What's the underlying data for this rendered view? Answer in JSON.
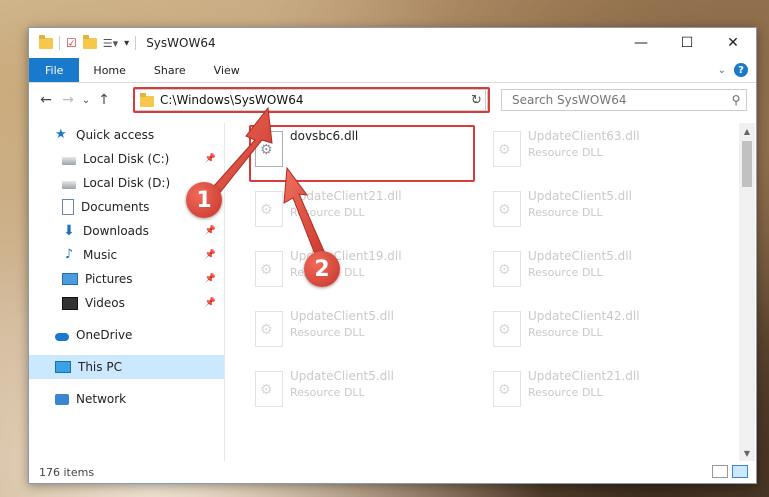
{
  "window": {
    "title": "SysWOW64",
    "controls": {
      "minimize": "—",
      "maximize": "☐",
      "close": "✕"
    }
  },
  "ribbon": {
    "tabs": [
      "File",
      "Home",
      "Share",
      "View"
    ],
    "expand_glyph": "⌄",
    "help": "?"
  },
  "navbar": {
    "back": "←",
    "forward": "→",
    "recent": "⌄",
    "up": "↑",
    "address": "C:\\Windows\\SysWOW64",
    "address_dropdown": "⌄",
    "refresh": "↻",
    "search_placeholder": "Search SysWOW64",
    "search_icon": "⚲"
  },
  "sidebar": {
    "items": [
      {
        "label": "Quick access",
        "icon": "star-icon",
        "pinned": false
      },
      {
        "label": "Local Disk (C:)",
        "icon": "drive-icon",
        "pinned": true
      },
      {
        "label": "Local Disk (D:)",
        "icon": "drive-icon",
        "pinned": false
      },
      {
        "label": "Documents",
        "icon": "documents-icon",
        "pinned": true
      },
      {
        "label": "Downloads",
        "icon": "download-icon",
        "pinned": true
      },
      {
        "label": "Music",
        "icon": "music-icon",
        "pinned": true
      },
      {
        "label": "Pictures",
        "icon": "pictures-icon",
        "pinned": true
      },
      {
        "label": "Videos",
        "icon": "videos-icon",
        "pinned": true
      },
      {
        "label": "OneDrive",
        "icon": "cloud-icon",
        "pinned": false
      },
      {
        "label": "This PC",
        "icon": "computer-icon",
        "pinned": false,
        "selected": true
      },
      {
        "label": "Network",
        "icon": "network-icon",
        "pinned": false
      }
    ],
    "pin_glyph": "📌"
  },
  "files": [
    {
      "name": "dovsbc6.dll",
      "type": "",
      "highlighted": true
    },
    {
      "name": "UpdateClient63.dll",
      "type": "Resource DLL"
    },
    {
      "name": "UpdateClient21.dll",
      "type": "Resource DLL"
    },
    {
      "name": "UpdateClient5.dll",
      "type": "Resource DLL"
    },
    {
      "name": "UpdateClient19.dll",
      "type": "Resource DLL"
    },
    {
      "name": "UpdateClient5.dll",
      "type": "Resource DLL"
    },
    {
      "name": "UpdateClient5.dll",
      "type": "Resource DLL"
    },
    {
      "name": "UpdateClient42.dll",
      "type": "Resource DLL"
    },
    {
      "name": "UpdateClient5.dll",
      "type": "Resource DLL"
    },
    {
      "name": "UpdateClient21.dll",
      "type": "Resource DLL"
    }
  ],
  "status": {
    "item_count": "176 items"
  },
  "annotations": {
    "step1": "1",
    "step2": "2",
    "color": "#d93a3a"
  }
}
